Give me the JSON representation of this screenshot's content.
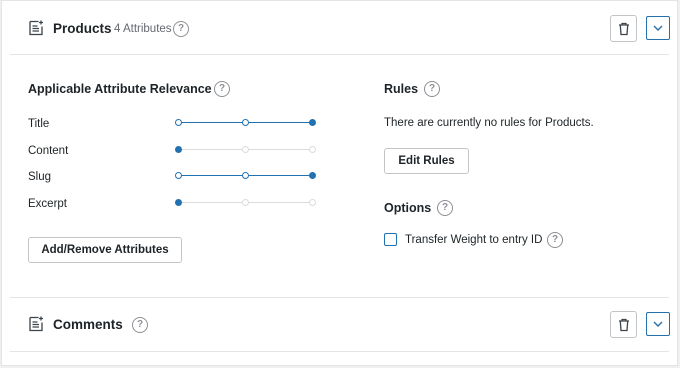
{
  "products": {
    "title": "Products",
    "attribute_count": "4 Attributes",
    "relevance_title": "Applicable Attribute Relevance",
    "attributes": [
      {
        "label": "Title",
        "level": 2,
        "max": 2
      },
      {
        "label": "Content",
        "level": 0,
        "max": 2
      },
      {
        "label": "Slug",
        "level": 2,
        "max": 2
      },
      {
        "label": "Excerpt",
        "level": 0,
        "max": 2
      }
    ],
    "add_remove_label": "Add/Remove Attributes",
    "rules_title": "Rules",
    "rules_text": "There are currently no rules for Products.",
    "edit_rules_label": "Edit Rules",
    "options_title": "Options",
    "transfer_weight_label": "Transfer Weight to entry ID",
    "transfer_weight_checked": false
  },
  "comments": {
    "title": "Comments"
  },
  "help_glyph": "?",
  "colors": {
    "accent": "#2271b1",
    "border": "#c3c4c7",
    "text": "#1d2327",
    "muted": "#646970"
  }
}
